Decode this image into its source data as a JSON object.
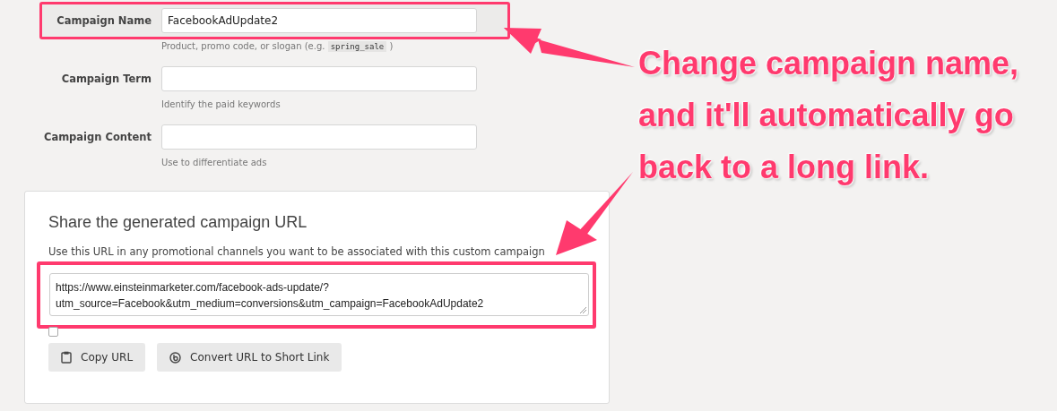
{
  "fields": [
    {
      "label": "Campaign Name",
      "value": "FacebookAdUpdate2",
      "hint": "Product, promo code, or slogan (e.g. ",
      "hint_code": "spring_sale",
      "hint_after": " )",
      "highlighted": true
    },
    {
      "label": "Campaign Term",
      "hint": "Identify the paid keywords",
      "highlighted": false
    },
    {
      "label": "Campaign Content",
      "hint": "Use to differentiate ads",
      "highlighted": false
    }
  ],
  "share": {
    "title": "Share the generated campaign URL",
    "description": "Use this URL in any promotional channels you want to be associated with this custom campaign",
    "url": "https://www.einsteinmarketer.com/facebook-ads-update/?utm_source=Facebook&utm_medium=conversions&utm_campaign=FacebookAdUpdate2",
    "highlighted": true,
    "fragment_checkbox": {
      "checked": false
    },
    "buttons": [
      {
        "label": "Copy URL",
        "kind": "copy"
      },
      {
        "label": "Convert URL to Short Link",
        "kind": "shorten"
      }
    ]
  },
  "annotation": {
    "text": "Change campaign name, and it'll automatically go back to a long link."
  }
}
